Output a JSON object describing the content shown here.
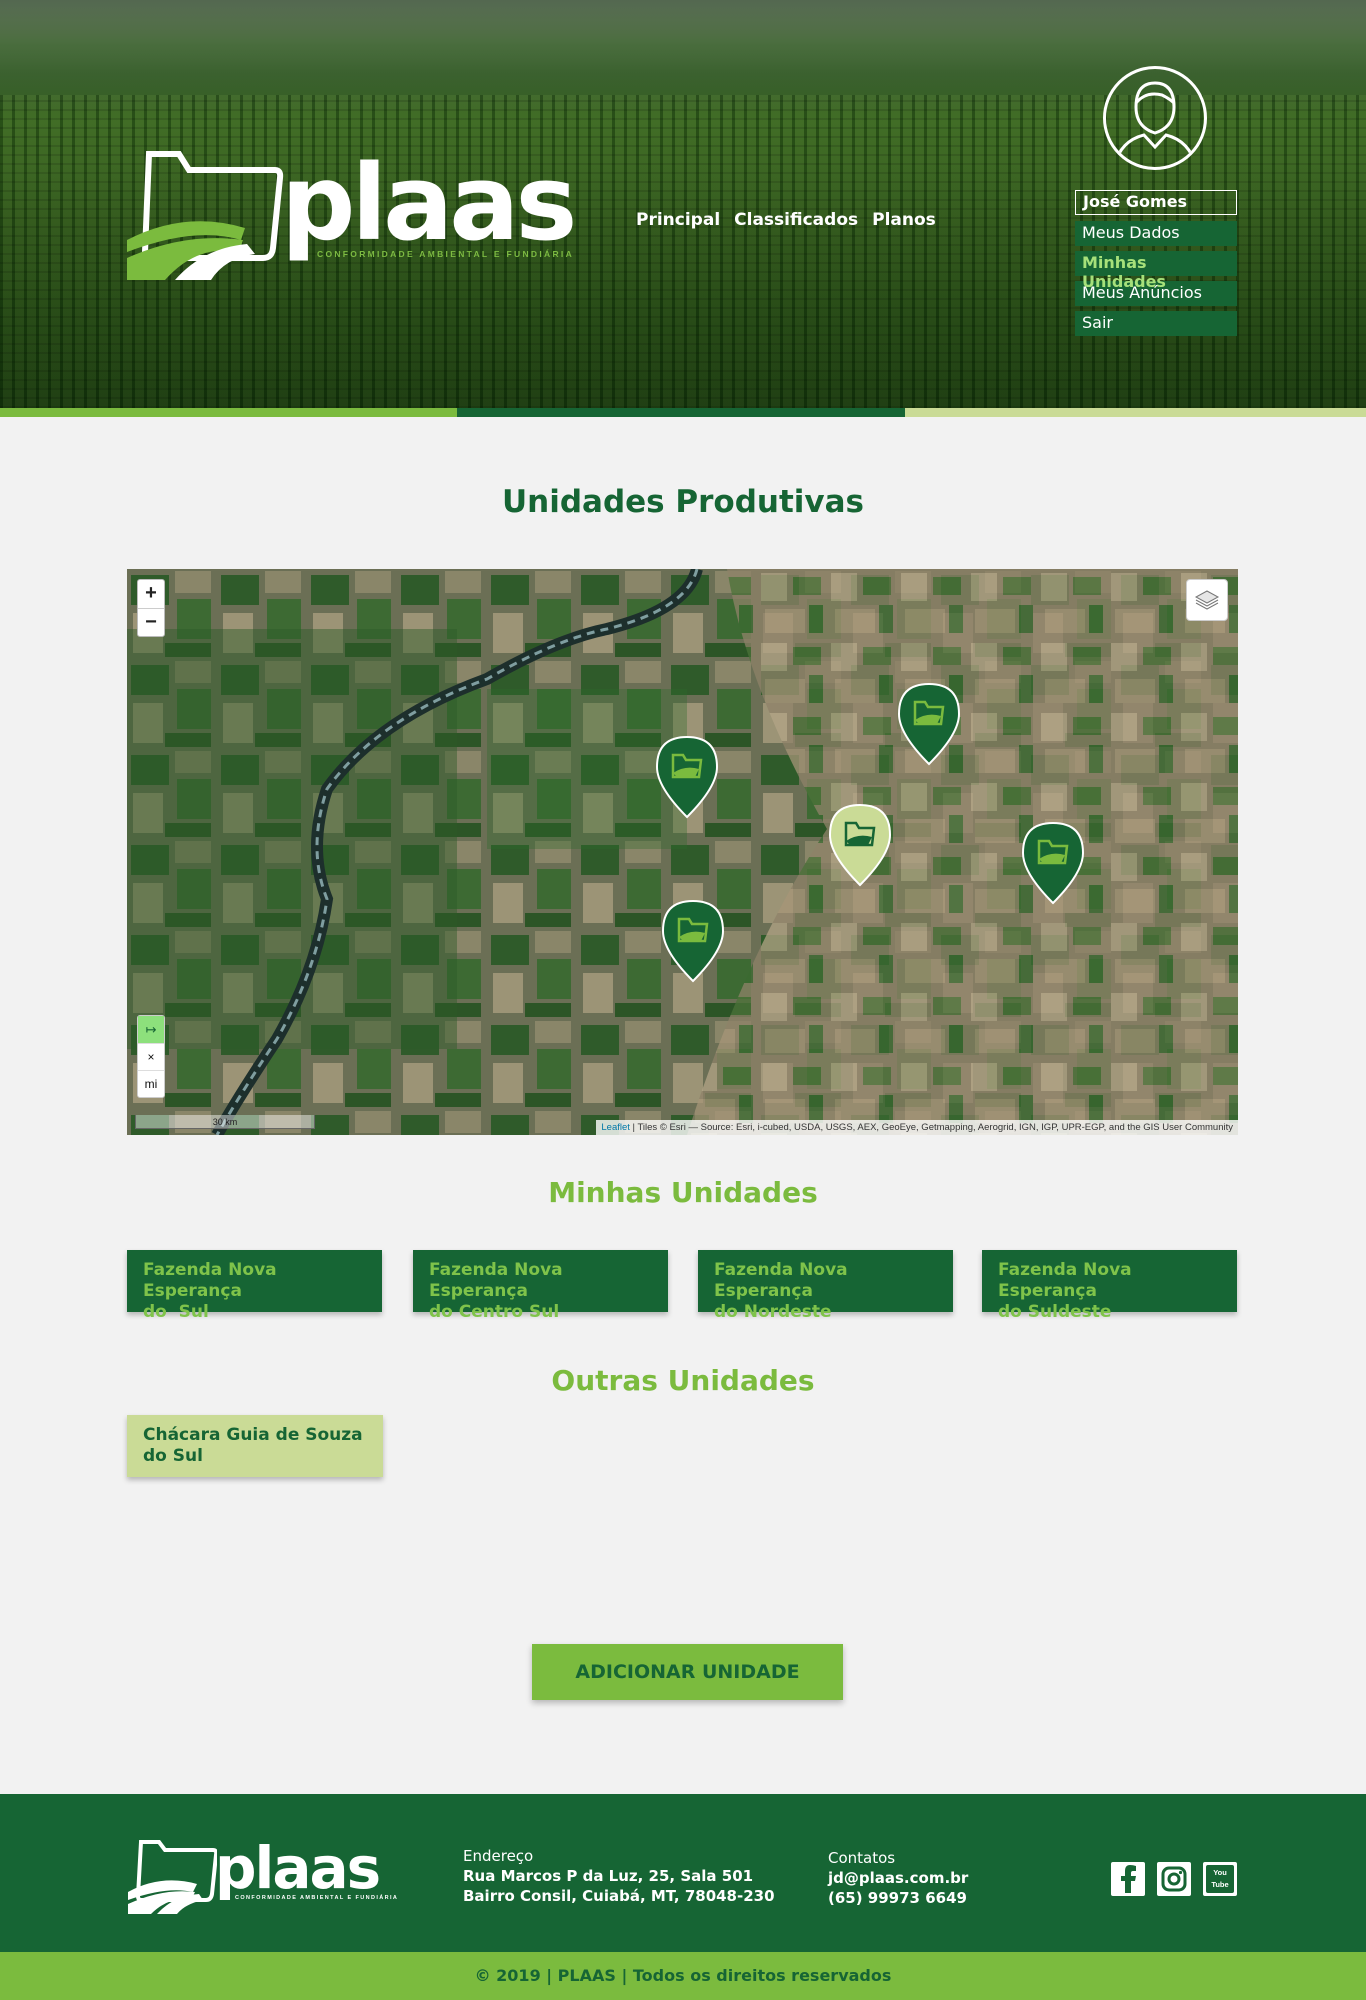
{
  "header": {
    "logo_text": "plaas",
    "logo_tagline": "CONFORMIDADE AMBIENTAL E FUNDIÁRIA",
    "nav": [
      "Principal",
      "Classificados",
      "Planos"
    ],
    "user": {
      "name": "José Gomes",
      "menu": [
        "Meus Dados",
        "Minhas Unidades",
        "Meus Anúncios",
        "Sair"
      ],
      "active_item": "Minhas Unidades"
    },
    "stripe_colors": [
      "#7bbb3e",
      "#166534",
      "#cadb96"
    ]
  },
  "main": {
    "title": "Unidades Produtivas",
    "map": {
      "zoom_in": "+",
      "zoom_out": "−",
      "measure_buttons": [
        "↦",
        "×",
        "mi"
      ],
      "scale_label": "30 km",
      "attribution_leaflet": "Leaflet",
      "attribution_rest": " | Tiles © Esri — Source: Esri, i-cubed, USDA, USGS, AEX, GeoEye, Getmapping, Aerogrid, IGN, IGP, UPR-EGP, and the GIS User Community",
      "markers": [
        {
          "kind": "mine",
          "color": "#166534"
        },
        {
          "kind": "mine",
          "color": "#166534"
        },
        {
          "kind": "other",
          "color": "#cadb96"
        },
        {
          "kind": "mine",
          "color": "#166534"
        },
        {
          "kind": "mine",
          "color": "#166534"
        }
      ]
    },
    "my_units_title": "Minhas Unidades",
    "my_units": [
      {
        "line1": "Fazenda Nova Esperança",
        "line2": "do  Sul"
      },
      {
        "line1": "Fazenda Nova Esperança",
        "line2": "do Centro Sul"
      },
      {
        "line1": "Fazenda Nova Esperança",
        "line2": "do Nordeste"
      },
      {
        "line1": "Fazenda Nova Esperança",
        "line2": "do Suldeste"
      }
    ],
    "other_units_title": "Outras Unidades",
    "other_units": [
      {
        "line1": "Chácara Guia de Souza",
        "line2": "do Sul"
      }
    ],
    "add_button": "ADICIONAR UNIDADE"
  },
  "footer": {
    "logo_text": "plaas",
    "logo_tagline": "CONFORMIDADE AMBIENTAL E FUNDIÁRIA",
    "address_label": "Endereço",
    "address_line1": "Rua Marcos P da Luz, 25, Sala 501",
    "address_line2": "Bairro Consil, Cuiabá, MT, 78048-230",
    "contacts_label": "Contatos",
    "email": "jd@plaas.com.br",
    "phone": "(65) 99973 6649",
    "social": [
      "facebook-icon",
      "instagram-icon",
      "youtube-icon"
    ],
    "youtube_label": "You Tube",
    "copyright": "© 2019 | PLAAS | Todos os direitos reservados"
  },
  "colors": {
    "dark_green": "#166534",
    "light_green": "#7bbb3e",
    "pale_green": "#cadb96",
    "background": "#f2f2f2"
  }
}
